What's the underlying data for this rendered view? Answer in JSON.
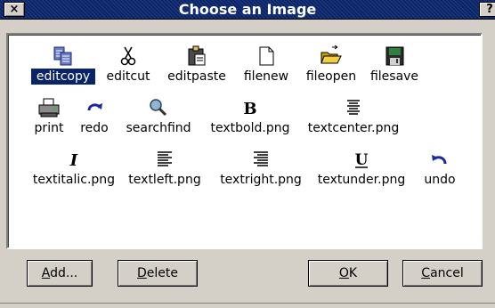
{
  "window": {
    "title": "Choose an Image",
    "close_glyph": "×",
    "help_glyph": "?"
  },
  "icons": [
    {
      "label": "editcopy",
      "icon": "editcopy-icon",
      "selected": true
    },
    {
      "label": "editcut",
      "icon": "editcut-icon"
    },
    {
      "label": "editpaste",
      "icon": "editpaste-icon"
    },
    {
      "label": "filenew",
      "icon": "filenew-icon"
    },
    {
      "label": "fileopen",
      "icon": "fileopen-icon"
    },
    {
      "label": "filesave",
      "icon": "filesave-icon"
    },
    {
      "label": "print",
      "icon": "print-icon"
    },
    {
      "label": "redo",
      "icon": "redo-icon"
    },
    {
      "label": "searchfind",
      "icon": "searchfind-icon"
    },
    {
      "label": "textbold.png",
      "icon": "textbold-icon"
    },
    {
      "label": "textcenter.png",
      "icon": "textcenter-icon"
    },
    {
      "label": "textitalic.png",
      "icon": "textitalic-icon"
    },
    {
      "label": "textleft.png",
      "icon": "textleft-icon"
    },
    {
      "label": "textright.png",
      "icon": "textright-icon"
    },
    {
      "label": "textunder.png",
      "icon": "textunder-icon"
    },
    {
      "label": "undo",
      "icon": "undo-icon"
    }
  ],
  "buttons": {
    "add": {
      "mnemonic": "A",
      "rest": "dd..."
    },
    "delete": {
      "mnemonic": "D",
      "rest": "elete"
    },
    "ok": {
      "mnemonic": "O",
      "rest": "K"
    },
    "cancel": {
      "mnemonic": "C",
      "rest": "ancel"
    }
  },
  "colors": {
    "selection": "#0a246a",
    "titlebar": "#0a246a",
    "dialog_bg": "#d4d0c8",
    "view_bg": "#ffffff"
  }
}
